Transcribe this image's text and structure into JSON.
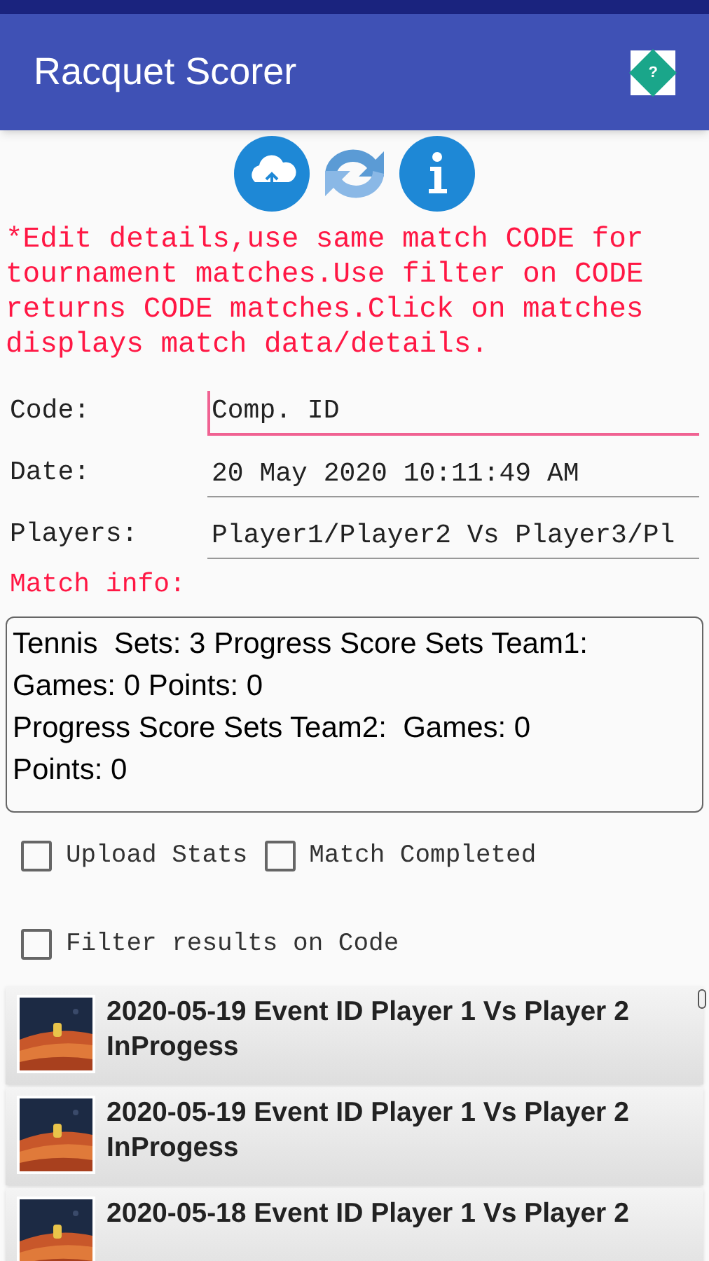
{
  "app_bar": {
    "title": "Racquet Scorer",
    "help_glyph": "?"
  },
  "note_lines": [
    "*Edit details,use same match CODE for",
    "tournament matches.Use filter on CODE",
    "returns CODE matches.Click on matches",
    "displays match data/details."
  ],
  "fields": [
    {
      "label": "Code:",
      "value": "Comp. ID",
      "focused": true
    },
    {
      "label": "Date:",
      "value": "20 May 2020 10:11:49 AM",
      "focused": false
    },
    {
      "label": "Players:",
      "value": "Player1/Player2 Vs Player3/Pl",
      "focused": false
    }
  ],
  "match_info": {
    "label": "Match info:",
    "lines": [
      "Tennis  Sets: 3 Progress Score Sets Team1:",
      "Games: 0 Points: 0",
      "Progress Score Sets Team2:  Games: 0",
      "Points: 0"
    ]
  },
  "checkbox_rows": [
    [
      {
        "label": "Upload Stats",
        "checked": false
      },
      {
        "label": "Match Completed",
        "checked": false
      }
    ],
    [
      {
        "label": "Filter results on Code",
        "checked": false
      }
    ]
  ],
  "matches": [
    {
      "title": "2020-05-19 Event ID Player 1 Vs Player 2",
      "status": "InProgess"
    },
    {
      "title": "2020-05-19 Event ID Player 1 Vs Player 2",
      "status": "InProgess"
    },
    {
      "title": "2020-05-18 Event ID Player 1 Vs Player 2"
    }
  ]
}
